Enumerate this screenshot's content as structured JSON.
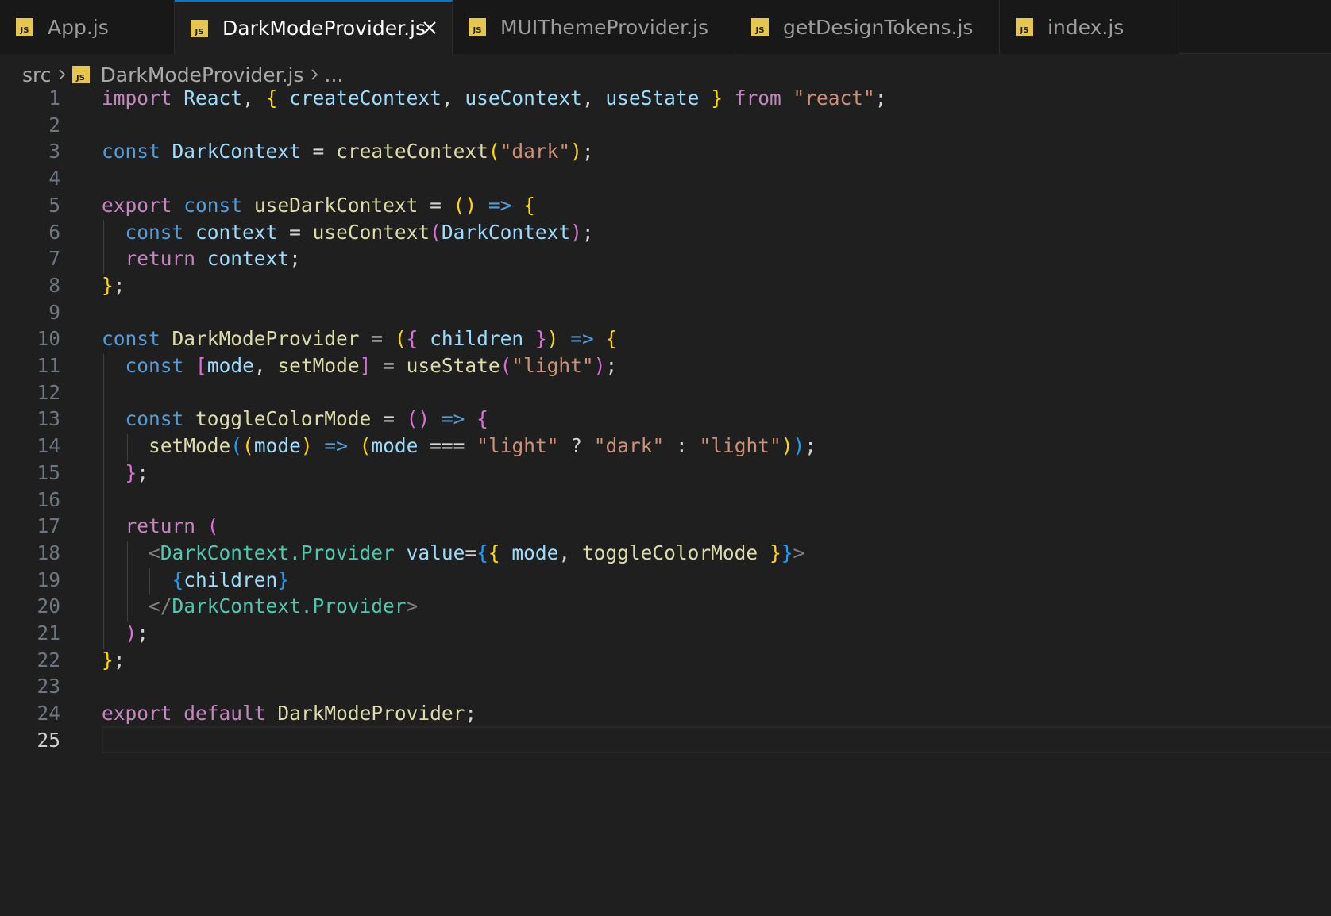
{
  "tabs": [
    {
      "label": "App.js",
      "active": false
    },
    {
      "label": "DarkModeProvider.js",
      "active": true
    },
    {
      "label": "MUIThemeProvider.js",
      "active": false
    },
    {
      "label": "getDesignTokens.js",
      "active": false
    },
    {
      "label": "index.js",
      "active": false
    }
  ],
  "breadcrumb": {
    "folder": "src",
    "file": "DarkModeProvider.js",
    "more": "..."
  },
  "current_line": 25,
  "lines": [
    [
      [
        "kw",
        "import"
      ],
      [
        "p",
        " "
      ],
      [
        "var",
        "React"
      ],
      [
        "p",
        ", "
      ],
      [
        "b1",
        "{"
      ],
      [
        "p",
        " "
      ],
      [
        "var",
        "createContext"
      ],
      [
        "p",
        ", "
      ],
      [
        "var",
        "useContext"
      ],
      [
        "p",
        ", "
      ],
      [
        "var",
        "useState"
      ],
      [
        "p",
        " "
      ],
      [
        "b1",
        "}"
      ],
      [
        "p",
        " "
      ],
      [
        "kw",
        "from"
      ],
      [
        "p",
        " "
      ],
      [
        "str",
        "\"react\""
      ],
      [
        "p",
        ";"
      ]
    ],
    [],
    [
      [
        "st",
        "const"
      ],
      [
        "p",
        " "
      ],
      [
        "var",
        "DarkContext"
      ],
      [
        "p",
        " = "
      ],
      [
        "fn",
        "createContext"
      ],
      [
        "b1",
        "("
      ],
      [
        "str",
        "\"dark\""
      ],
      [
        "b1",
        ")"
      ],
      [
        "p",
        ";"
      ]
    ],
    [],
    [
      [
        "kw",
        "export"
      ],
      [
        "p",
        " "
      ],
      [
        "st",
        "const"
      ],
      [
        "p",
        " "
      ],
      [
        "fn",
        "useDarkContext"
      ],
      [
        "p",
        " = "
      ],
      [
        "b1",
        "()"
      ],
      [
        "p",
        " "
      ],
      [
        "st",
        "=>"
      ],
      [
        "p",
        " "
      ],
      [
        "b1",
        "{"
      ]
    ],
    [
      [
        "p",
        "  "
      ],
      [
        "st",
        "const"
      ],
      [
        "p",
        " "
      ],
      [
        "var",
        "context"
      ],
      [
        "p",
        " = "
      ],
      [
        "fn",
        "useContext"
      ],
      [
        "b2",
        "("
      ],
      [
        "var",
        "DarkContext"
      ],
      [
        "b2",
        ")"
      ],
      [
        "p",
        ";"
      ]
    ],
    [
      [
        "p",
        "  "
      ],
      [
        "kw",
        "return"
      ],
      [
        "p",
        " "
      ],
      [
        "var",
        "context"
      ],
      [
        "p",
        ";"
      ]
    ],
    [
      [
        "b1",
        "}"
      ],
      [
        "p",
        ";"
      ]
    ],
    [],
    [
      [
        "st",
        "const"
      ],
      [
        "p",
        " "
      ],
      [
        "fn",
        "DarkModeProvider"
      ],
      [
        "p",
        " = "
      ],
      [
        "b1",
        "("
      ],
      [
        "b2",
        "{"
      ],
      [
        "p",
        " "
      ],
      [
        "var",
        "children"
      ],
      [
        "p",
        " "
      ],
      [
        "b2",
        "}"
      ],
      [
        "b1",
        ")"
      ],
      [
        "p",
        " "
      ],
      [
        "st",
        "=>"
      ],
      [
        "p",
        " "
      ],
      [
        "b1",
        "{"
      ]
    ],
    [
      [
        "p",
        "  "
      ],
      [
        "st",
        "const"
      ],
      [
        "p",
        " "
      ],
      [
        "b2",
        "["
      ],
      [
        "var",
        "mode"
      ],
      [
        "p",
        ", "
      ],
      [
        "fn",
        "setMode"
      ],
      [
        "b2",
        "]"
      ],
      [
        "p",
        " = "
      ],
      [
        "fn",
        "useState"
      ],
      [
        "b2",
        "("
      ],
      [
        "str",
        "\"light\""
      ],
      [
        "b2",
        ")"
      ],
      [
        "p",
        ";"
      ]
    ],
    [],
    [
      [
        "p",
        "  "
      ],
      [
        "st",
        "const"
      ],
      [
        "p",
        " "
      ],
      [
        "fn",
        "toggleColorMode"
      ],
      [
        "p",
        " = "
      ],
      [
        "b2",
        "()"
      ],
      [
        "p",
        " "
      ],
      [
        "st",
        "=>"
      ],
      [
        "p",
        " "
      ],
      [
        "b2",
        "{"
      ]
    ],
    [
      [
        "p",
        "    "
      ],
      [
        "fn",
        "setMode"
      ],
      [
        "b3",
        "("
      ],
      [
        "b1",
        "("
      ],
      [
        "var",
        "mode"
      ],
      [
        "b1",
        ")"
      ],
      [
        "p",
        " "
      ],
      [
        "st",
        "=>"
      ],
      [
        "p",
        " "
      ],
      [
        "b1",
        "("
      ],
      [
        "var",
        "mode"
      ],
      [
        "p",
        " === "
      ],
      [
        "str",
        "\"light\""
      ],
      [
        "p",
        " ? "
      ],
      [
        "str",
        "\"dark\""
      ],
      [
        "p",
        " : "
      ],
      [
        "str",
        "\"light\""
      ],
      [
        "b1",
        ")"
      ],
      [
        "b3",
        ")"
      ],
      [
        "p",
        ";"
      ]
    ],
    [
      [
        "p",
        "  "
      ],
      [
        "b2",
        "}"
      ],
      [
        "p",
        ";"
      ]
    ],
    [],
    [
      [
        "p",
        "  "
      ],
      [
        "kw",
        "return"
      ],
      [
        "p",
        " "
      ],
      [
        "b2",
        "("
      ]
    ],
    [
      [
        "p",
        "    "
      ],
      [
        "tag",
        "<"
      ],
      [
        "ty",
        "DarkContext.Provider"
      ],
      [
        "p",
        " "
      ],
      [
        "var",
        "value"
      ],
      [
        "p",
        "="
      ],
      [
        "b3",
        "{"
      ],
      [
        "b1",
        "{"
      ],
      [
        "p",
        " "
      ],
      [
        "var",
        "mode"
      ],
      [
        "p",
        ", "
      ],
      [
        "fn",
        "toggleColorMode"
      ],
      [
        "p",
        " "
      ],
      [
        "b1",
        "}"
      ],
      [
        "b3",
        "}"
      ],
      [
        "tag",
        ">"
      ]
    ],
    [
      [
        "p",
        "      "
      ],
      [
        "b3",
        "{"
      ],
      [
        "var",
        "children"
      ],
      [
        "b3",
        "}"
      ]
    ],
    [
      [
        "p",
        "    "
      ],
      [
        "tag",
        "</"
      ],
      [
        "ty",
        "DarkContext.Provider"
      ],
      [
        "tag",
        ">"
      ]
    ],
    [
      [
        "p",
        "  "
      ],
      [
        "b2",
        ")"
      ],
      [
        "p",
        ";"
      ]
    ],
    [
      [
        "b1",
        "}"
      ],
      [
        "p",
        ";"
      ]
    ],
    [],
    [
      [
        "kw",
        "export"
      ],
      [
        "p",
        " "
      ],
      [
        "kw",
        "default"
      ],
      [
        "p",
        " "
      ],
      [
        "fn",
        "DarkModeProvider"
      ],
      [
        "p",
        ";"
      ]
    ],
    []
  ],
  "colors": {
    "background": "#1f1f1f",
    "tab_bar": "#181818",
    "active_tab_border": "#0078d4",
    "js_icon": "#e6c74c"
  }
}
